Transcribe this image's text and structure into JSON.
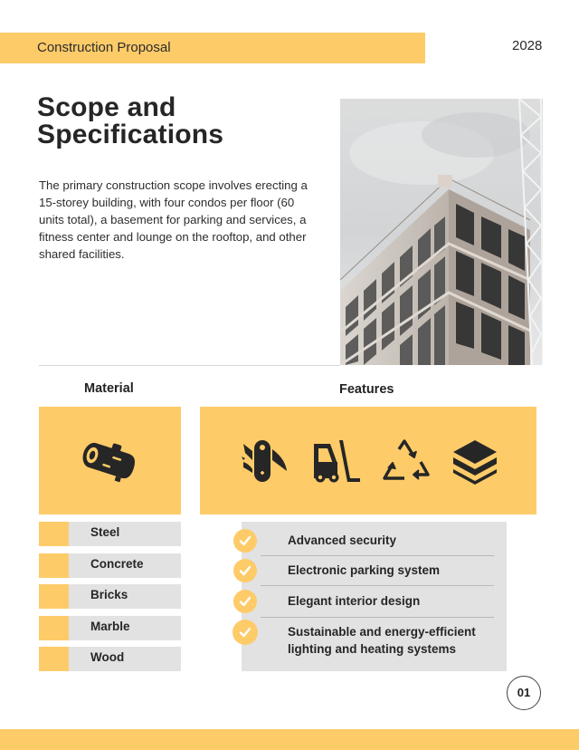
{
  "header": {
    "title": "Construction Proposal",
    "year": "2028"
  },
  "main": {
    "title_line1": "Scope and",
    "title_line2": "Specifications",
    "intro": "The primary construction scope involves erecting a 15-storey building, with four condos per floor (60 units total), a basement for parking and services, a fitness center and lounge on the rooftop, and other shared facilities.",
    "photo": {
      "subject": "building-under-construction-with-crane"
    }
  },
  "material": {
    "heading": "Material",
    "icon": "log-icon",
    "items": [
      {
        "label": "Steel"
      },
      {
        "label": "Concrete"
      },
      {
        "label": "Bricks"
      },
      {
        "label": "Marble"
      },
      {
        "label": "Wood"
      }
    ]
  },
  "features": {
    "heading": "Features",
    "icons": [
      "multi-tool-icon",
      "forklift-icon",
      "recycle-icon",
      "layers-icon"
    ],
    "items": [
      {
        "label": "Advanced security",
        "checked": true
      },
      {
        "label": "Electronic parking system",
        "checked": true
      },
      {
        "label": "Elegant interior design",
        "checked": true
      },
      {
        "label": "Sustainable and energy-efficient lighting and heating systems",
        "checked": true
      }
    ]
  },
  "footer": {
    "page_number": "01"
  },
  "colors": {
    "accent": "#fecb69",
    "panel_gray": "#e2e2e2",
    "text_dark": "#262626"
  }
}
